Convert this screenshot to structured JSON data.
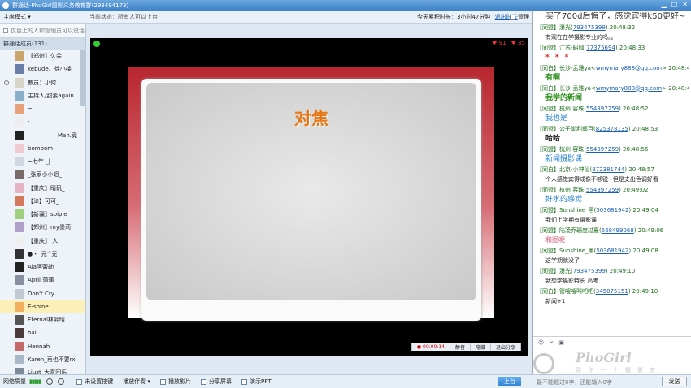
{
  "window": {
    "title": "群通话-PhoGirl摄影义务教育群(293494173)",
    "controls": [
      "▁",
      "□",
      "✕"
    ]
  },
  "toolbar": {
    "mode": "主席模式 ▾",
    "status": "当前状态：所有人可以上台",
    "today_time": "今天累积时长：3小时47分钟",
    "report_link": "退出时长",
    "settings": "管理"
  },
  "sidebar": {
    "notice": "仅台上的人和管理员可以说话",
    "header": "群通话成员(131)",
    "members": [
      {
        "name": "【郑州】久朵",
        "color": "#c9a56b"
      },
      {
        "name": "kebude、徐小楼",
        "color": "#6a7fa8"
      },
      {
        "name": "教员：小何",
        "color": "#d9d4c8",
        "marked": true
      },
      {
        "name": "主持人/甜素again",
        "color": "#8ab0c9"
      },
      {
        "name": "~",
        "color": "#e8a07a"
      },
      {
        "name": "-",
        "color": "#eeeeee"
      },
      {
        "name": "Man.竟",
        "color": "#222222",
        "right": true
      },
      {
        "name": "bombom",
        "color": "#f0c8d0"
      },
      {
        "name": "~七年 _|",
        "color": "#cfd8e0"
      },
      {
        "name": "_张家小小姐_",
        "color": "#7a6b6b"
      },
      {
        "name": "【重庆】晴矾_",
        "color": "#e6b4c4"
      },
      {
        "name": "【津】可可_",
        "color": "#d47a5a"
      },
      {
        "name": "【新疆】spiple",
        "color": "#9ecf7a"
      },
      {
        "name": "【郑州】my墨莉",
        "color": "#b0a0c8"
      },
      {
        "name": "【重庆】 人",
        "color": "#f0f0f0"
      },
      {
        "name": "●・_元^元",
        "color": "#333333"
      },
      {
        "name": "Ala阿蕾勒",
        "color": "#222222"
      },
      {
        "name": "April 蒲蒲",
        "color": "#8890a0"
      },
      {
        "name": "Don't Cry",
        "color": "#c0c8d0"
      },
      {
        "name": "E-shine",
        "color": "#f0b060",
        "selected": true
      },
      {
        "name": "Eternal林熙晴",
        "color": "#555555"
      },
      {
        "name": "hai",
        "color": "#4a3a3a"
      },
      {
        "name": "Hennah",
        "color": "#c46a6a"
      },
      {
        "name": "Karen_再也不要rx",
        "color": "#a8b8c8"
      },
      {
        "name": "Liuzt_大喜回乐",
        "color": "#7a8a9a"
      }
    ]
  },
  "stage": {
    "stats": {
      "flowers": "♥ 91",
      "hearts": "♥ 35"
    },
    "board_title": "对焦",
    "controls": [
      "● 00:00:14",
      "静音",
      "隐藏",
      "退出分享"
    ]
  },
  "chat": [
    {
      "type": "msg",
      "text": "买了700d后悔了，感觉宾得k50更好~",
      "style": "top"
    },
    {
      "type": "hdr",
      "role": "【同盟】",
      "name": "瀑光",
      "qq": "793475399",
      "time": "20:48:32"
    },
    {
      "type": "msg",
      "text": "有观在在学摄影专业的吗。。"
    },
    {
      "type": "hdr",
      "role": "【同盟】",
      "name": "江苏-昭鄢",
      "qq": "77375694",
      "time": "20:48:33"
    },
    {
      "type": "msg",
      "text": "* * *",
      "style": "red"
    },
    {
      "type": "hdr",
      "role": "【同白】",
      "name": "长沙-孟雅ya",
      "qq": "wmymary888@qq.com",
      "time": "20:48:41"
    },
    {
      "type": "msg",
      "text": "有啊",
      "style": "green"
    },
    {
      "type": "hdr",
      "role": "【同白】",
      "name": "长沙-孟雅ya",
      "qq": "wmymary888@qq.com",
      "time": "20:48:45"
    },
    {
      "type": "msg",
      "text": "我学的新闻",
      "style": "green"
    },
    {
      "type": "hdr",
      "role": "【同盟】",
      "name": "杭州 容珠",
      "qq": "554397259",
      "time": "20:48:52"
    },
    {
      "type": "msg",
      "text": "我也是",
      "style": "blue"
    },
    {
      "type": "hdr",
      "role": "【同盟】",
      "name": "公子呦利郎百",
      "qq": "825378135",
      "time": "20:48:53"
    },
    {
      "type": "msg",
      "text": "哈哈",
      "style": "big"
    },
    {
      "type": "hdr",
      "role": "【同盟】",
      "name": "杭州 容珠",
      "qq": "554397259",
      "time": "20:48:56"
    },
    {
      "type": "msg",
      "text": "新闻摄影课",
      "style": "blue"
    },
    {
      "type": "hdr",
      "role": "【同白】",
      "name": "北京-小神仙",
      "qq": "872381744",
      "time": "20:48:57"
    },
    {
      "type": "msg",
      "text": "个人感觉宾得成像不够锐~但是支出色调好看"
    },
    {
      "type": "hdr",
      "role": "【同盟】",
      "name": "杭州 容珠",
      "qq": "554397259",
      "time": "20:49:02"
    },
    {
      "type": "msg",
      "text": "好水的感觉",
      "style": "blue"
    },
    {
      "type": "hdr",
      "role": "【同盟】",
      "name": "Sunshine_黑",
      "qq": "503681942",
      "time": "20:49:04"
    },
    {
      "type": "msg",
      "text": "我们上学期有摄影课"
    },
    {
      "type": "hdr",
      "role": "【同盟】",
      "name": "陆凌乔珊度过夏",
      "qq": "568499068",
      "time": "20:49:06"
    },
    {
      "type": "msg",
      "text": "和图呢",
      "style": "pink"
    },
    {
      "type": "hdr",
      "role": "【同盟】",
      "name": "Sunshine_黑",
      "qq": "503681942",
      "time": "20:49:08"
    },
    {
      "type": "msg",
      "text": "这学期就没了"
    },
    {
      "type": "hdr",
      "role": "【同盟】",
      "name": "瀑光",
      "qq": "793475399",
      "time": "20:49:10"
    },
    {
      "type": "msg",
      "text": "我想学摄影特长  高考"
    },
    {
      "type": "hdr",
      "role": "【同白】",
      "name": "管嗖嗖叫吧吧",
      "qq": "345075151",
      "time": "20:49:10"
    },
    {
      "type": "msg",
      "text": "新闻+1"
    }
  ],
  "chat_tools": [
    "☺",
    "✂",
    "▣"
  ],
  "watermark": {
    "brand": "PhoGirl",
    "sub": "我 你 一 个 摄 影 梦"
  },
  "footer": {
    "network": "网络质量",
    "meter": "▮▮▮▮▮",
    "items": [
      "未设置按键",
      "播放伴奏 ▾",
      "播放影片",
      "分享屏幕",
      "演示PPT"
    ],
    "up_button": "上台",
    "counter": "最不能超过0字，还能输入0字",
    "send": "发送"
  }
}
